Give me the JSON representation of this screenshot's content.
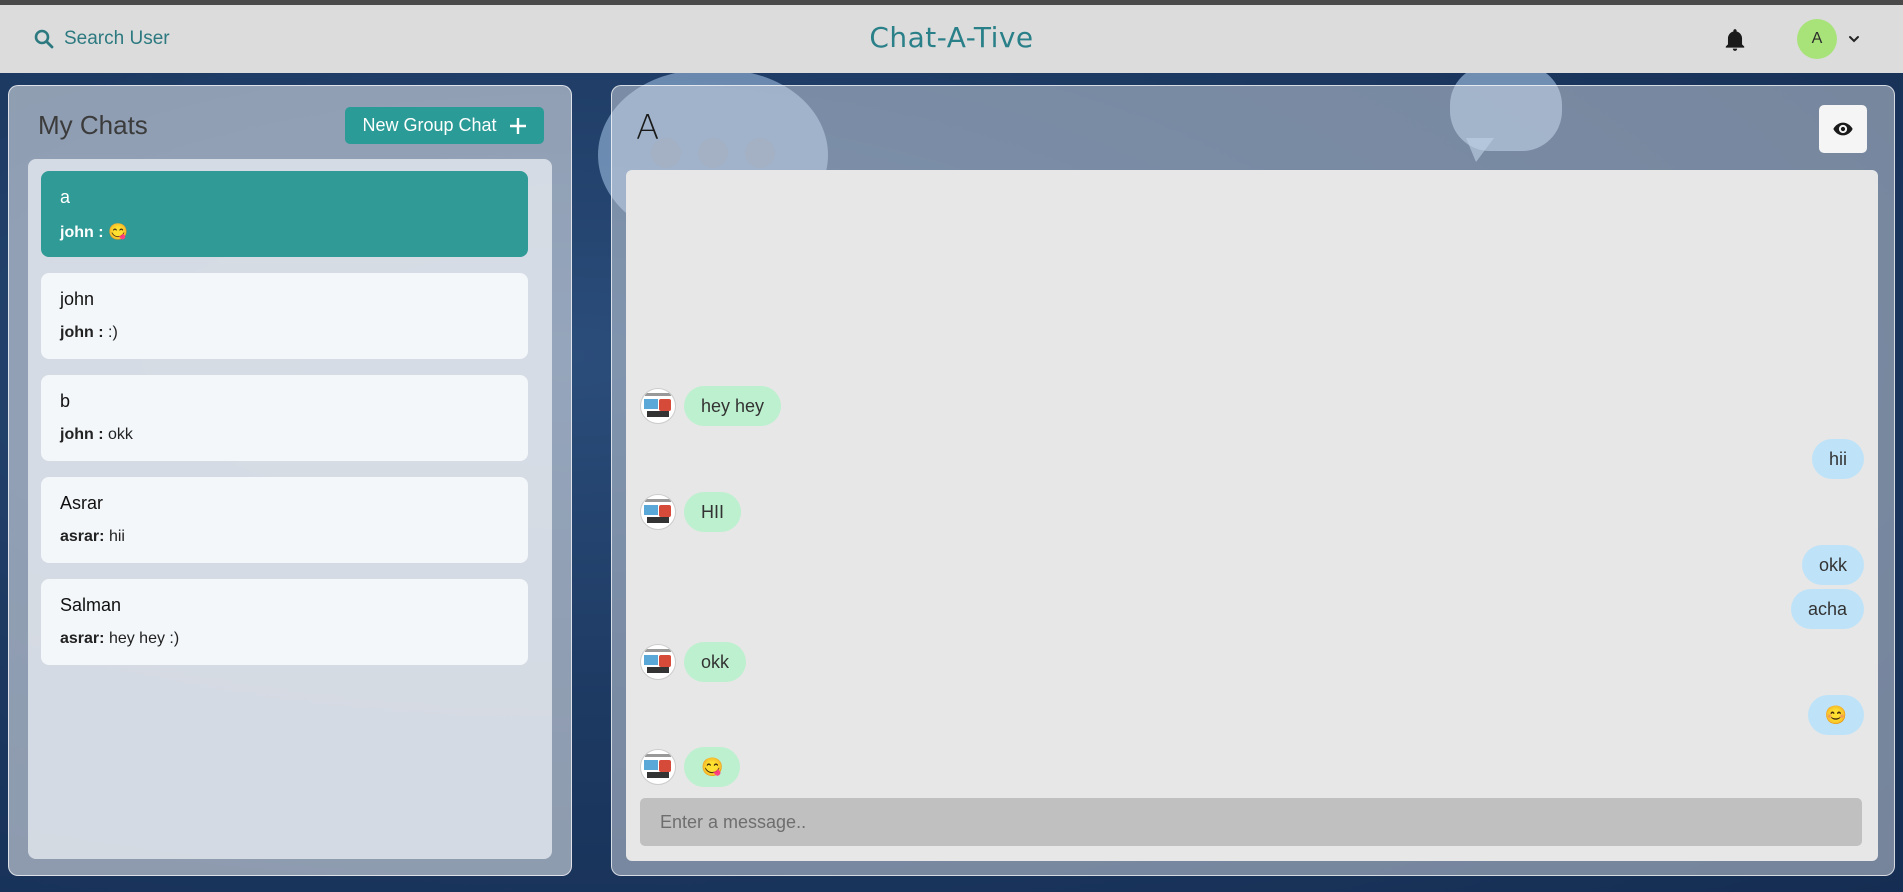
{
  "header": {
    "search_label": "Search User",
    "app_title": "Chat-A-Tive",
    "avatar_initial": "A",
    "icons": {
      "search": "search-icon",
      "bell": "bell-icon",
      "chevron": "chevron-down-icon"
    }
  },
  "sidebar": {
    "title": "My Chats",
    "new_group_label": "New Group Chat",
    "chats": [
      {
        "name": "a",
        "sender": "john :",
        "message": "😋",
        "active": true
      },
      {
        "name": "john",
        "sender": "john :",
        "message": ":)",
        "active": false
      },
      {
        "name": "b",
        "sender": "john :",
        "message": "okk",
        "active": false
      },
      {
        "name": "Asrar",
        "sender": "asrar:",
        "message": "hii",
        "active": false
      },
      {
        "name": "Salman",
        "sender": "asrar:",
        "message": "hey hey :)",
        "active": false
      }
    ]
  },
  "chat": {
    "title": "A",
    "view_icon": "eye-icon",
    "messages": [
      {
        "direction": "in",
        "text": "hey hey"
      },
      {
        "direction": "out",
        "text": "hii"
      },
      {
        "direction": "in",
        "text": "HII"
      },
      {
        "direction": "out",
        "text": "okk"
      },
      {
        "direction": "out",
        "text": "acha"
      },
      {
        "direction": "in",
        "text": "okk"
      },
      {
        "direction": "out",
        "text": "😊"
      },
      {
        "direction": "in",
        "text": "😋"
      }
    ],
    "input_placeholder": "Enter a message.."
  },
  "colors": {
    "accent": "#2a9b96",
    "active_chat": "#2f9a96",
    "incoming_bubble": "#bdf0cf",
    "outgoing_bubble": "#bee3f8",
    "avatar": "#a8e37a"
  }
}
